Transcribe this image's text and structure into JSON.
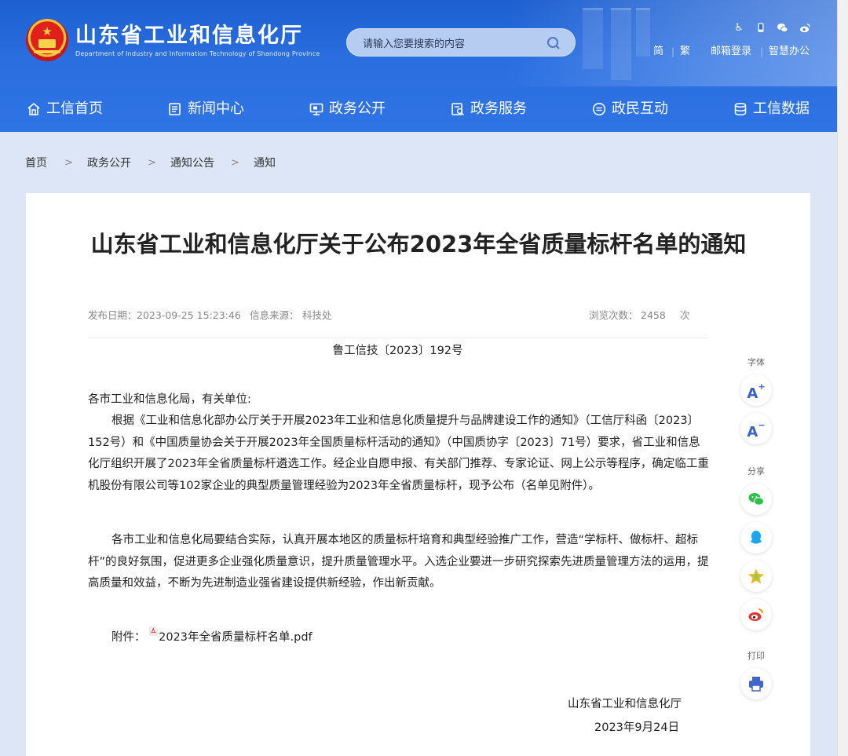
{
  "site": {
    "title": "山东省工业和信息化厅",
    "subtitle": "Department of Industry and Information Technology of Shandong Province"
  },
  "search": {
    "placeholder": "请输入您要搜索的内容",
    "icon": "search-icon"
  },
  "top_icons": [
    "accessibility-icon",
    "mobile-icon",
    "wechat-icon",
    "weibo-icon"
  ],
  "top_links": {
    "simplified": "简",
    "traditional": "繁",
    "mail": "邮箱登录",
    "office": "智慧办公"
  },
  "nav": {
    "items": [
      {
        "label": "工信首页",
        "icon": "home-icon"
      },
      {
        "label": "新闻中心",
        "icon": "news-icon"
      },
      {
        "label": "政务公开",
        "icon": "monitor-icon"
      },
      {
        "label": "政务服务",
        "icon": "service-icon"
      },
      {
        "label": "政民互动",
        "icon": "chat-icon"
      },
      {
        "label": "工信数据",
        "icon": "database-icon"
      }
    ]
  },
  "breadcrumb": {
    "items": [
      "首页",
      "政务公开",
      "通知公告",
      "通知"
    ],
    "separator": ">"
  },
  "article": {
    "title": "山东省工业和信息化厅关于公布2023年全省质量标杆名单的通知",
    "meta": {
      "date_label": "发布日期：",
      "date": "2023-09-25 15:23:46",
      "source_label": "信息来源：",
      "source": "科技处",
      "views_label": "浏览次数：",
      "views": "2458",
      "views_unit": "次"
    },
    "doc_number": "鲁工信技〔2023〕192号",
    "salutation": "各市工业和信息化局，有关单位:",
    "paragraphs": [
      "根据《工业和信息化部办公厅关于开展2023年工业和信息化质量提升与品牌建设工作的通知》（工信厅科函〔2023〕152号）和《中国质量协会关于开展2023年全国质量标杆活动的通知》（中国质协字〔2023〕71号）要求，省工业和信息化厅组织开展了2023年全省质量标杆遴选工作。经企业自愿申报、有关部门推荐、专家论证、网上公示等程序，确定临工重机股份有限公司等102家企业的典型质量管理经验为2023年全省质量标杆，现予公布（名单见附件）。",
      "各市工业和信息化局要结合实际，认真开展本地区的质量标杆培育和典型经验推广工作，营造“学标杆、做标杆、超标杆”的良好氛围，促进更多企业强化质量意识，提升质量管理水平。入选企业要进一步研究探索先进质量管理方法的运用，提高质量和效益，不断为先进制造业强省建设提供新经验，作出新贡献。"
    ],
    "attachment_label": "附件：",
    "attachment_name": "2023年全省质量标杆名单.pdf",
    "signature_org": "山东省工业和信息化厅",
    "signature_date": "2023年9月24日"
  },
  "sidebar_tools": {
    "font_label": "字体",
    "font_increase": "A",
    "font_decrease": "A",
    "share_label": "分享",
    "print_label": "打印"
  }
}
